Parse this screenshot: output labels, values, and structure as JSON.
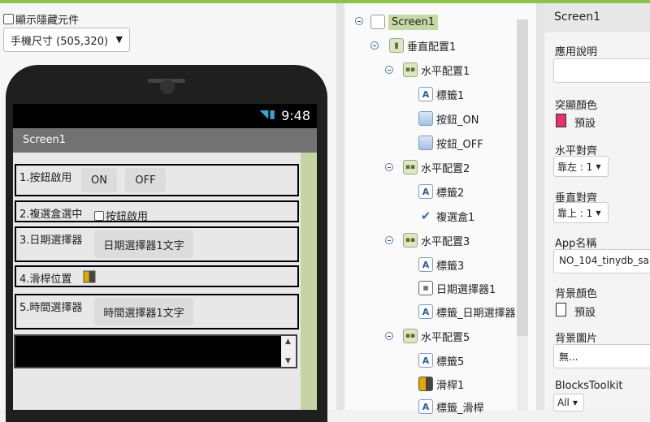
{
  "viewer": {
    "show_hidden_label": "顯示隱藏元件",
    "size_select_value": "手機尺寸 (505,320)",
    "status_time": "9:48",
    "screen_title": "Screen1",
    "rows": [
      {
        "label": "1.按鈕啟用",
        "buttons": [
          "ON",
          "OFF"
        ]
      },
      {
        "label": "2.複選盒選中",
        "checkbox_label": "按鈕啟用"
      },
      {
        "label": "3.日期選擇器",
        "button": "日期選擇器1文字"
      },
      {
        "label": "4.滑桿位置"
      },
      {
        "label": "5.時間選擇器",
        "button": "時間選擇器1文字"
      }
    ]
  },
  "components": {
    "items": [
      {
        "label": "Screen1",
        "icon": "screen-icon"
      },
      {
        "label": "垂直配置1",
        "icon": "vertical-arrangement-icon"
      },
      {
        "label": "水平配置1",
        "icon": "horizontal-arrangement-icon"
      },
      {
        "label": "標籤1",
        "icon": "label-icon"
      },
      {
        "label": "按鈕_ON",
        "icon": "button-icon"
      },
      {
        "label": "按鈕_OFF",
        "icon": "button-icon"
      },
      {
        "label": "水平配置2",
        "icon": "horizontal-arrangement-icon"
      },
      {
        "label": "標籤2",
        "icon": "label-icon"
      },
      {
        "label": "複選盒1",
        "icon": "checkbox-icon"
      },
      {
        "label": "水平配置3",
        "icon": "horizontal-arrangement-icon"
      },
      {
        "label": "標籤3",
        "icon": "label-icon"
      },
      {
        "label": "日期選擇器1",
        "icon": "datepicker-icon"
      },
      {
        "label": "標籤_日期選擇器",
        "icon": "label-icon"
      },
      {
        "label": "水平配置5",
        "icon": "horizontal-arrangement-icon"
      },
      {
        "label": "標籤5",
        "icon": "label-icon"
      },
      {
        "label": "滑桿1",
        "icon": "slider-icon"
      },
      {
        "label": "標籤_滑桿",
        "icon": "label-icon"
      }
    ]
  },
  "properties": {
    "header": "Screen1",
    "about_label": "應用說明",
    "about_value": "",
    "accent_label": "突顯顏色",
    "accent_value": "預設",
    "accent_color": "#e8316b",
    "align_h_label": "水平對齊",
    "align_h_value": "靠左 : 1",
    "align_v_label": "垂直對齊",
    "align_v_value": "靠上 : 1",
    "app_name_label": "App名稱",
    "app_name_value": "NO_104_tinydb_sa",
    "bg_color_label": "背景顏色",
    "bg_color_value": "預設",
    "bg_color": "#ffffff",
    "bg_image_label": "背景圖片",
    "bg_image_value": "無...",
    "blocks_toolkit_label": "BlocksToolkit",
    "blocks_toolkit_value": "All"
  }
}
